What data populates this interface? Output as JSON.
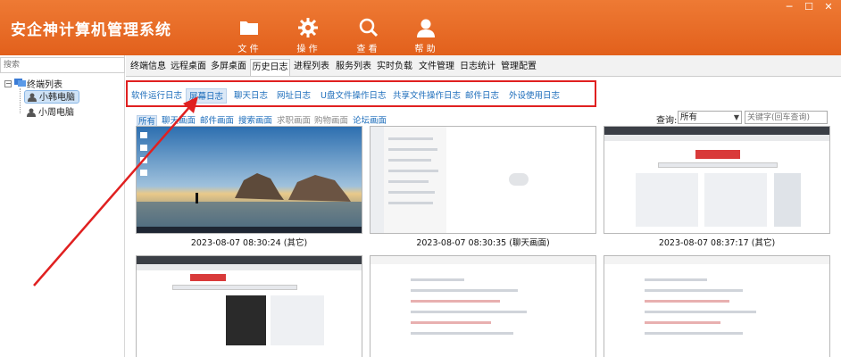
{
  "app": {
    "title": "安企神计算机管理系统"
  },
  "toolbar": [
    {
      "label": "文 件",
      "icon": "folder-icon"
    },
    {
      "label": "操 作",
      "icon": "gear-icon"
    },
    {
      "label": "查 看",
      "icon": "search-icon"
    },
    {
      "label": "帮 助",
      "icon": "user-help-icon"
    }
  ],
  "window": {
    "minimize": "─",
    "maximize": "☐",
    "close": "✕"
  },
  "left": {
    "search_placeholder": "搜索",
    "tree": {
      "root": "终端列表",
      "expander": "−",
      "nodes": [
        "小韩电脑",
        "小周电脑"
      ],
      "selected": 0
    }
  },
  "tabs": [
    "终端信息",
    "远程桌面",
    "多屏桌面",
    "历史日志",
    "进程列表",
    "服务列表",
    "实时负载",
    "文件管理",
    "日志统计",
    "管理配置"
  ],
  "active_tab": 3,
  "subtabs": [
    "软件运行日志",
    "屏幕日志",
    "聊天日志",
    "网址日志",
    "U盘文件操作日志",
    "共享文件操作日志",
    "邮件日志",
    "外设使用日志"
  ],
  "active_subtab": 1,
  "filters": [
    "所有",
    "聊天画面",
    "邮件画面",
    "搜索画面",
    "求职画面",
    "购物画面",
    "论坛画面"
  ],
  "active_filter": 0,
  "query": {
    "label": "查询:",
    "selected": "所有",
    "keyword_placeholder": "关键字(回车查询)"
  },
  "screenshots": [
    {
      "caption": "2023-08-07 08:30:24 (其它)",
      "kind": "desktop"
    },
    {
      "caption": "2023-08-07 08:30:35 (聊天画面)",
      "kind": "chat"
    },
    {
      "caption": "2023-08-07 08:37:17 (其它)",
      "kind": "web"
    },
    {
      "caption": "",
      "kind": "web"
    },
    {
      "caption": "",
      "kind": "doc"
    },
    {
      "caption": "",
      "kind": "doc"
    }
  ],
  "colors": {
    "titlebar": "#e8692a",
    "highlight_box": "#e02020",
    "link": "#1c6dbb"
  }
}
